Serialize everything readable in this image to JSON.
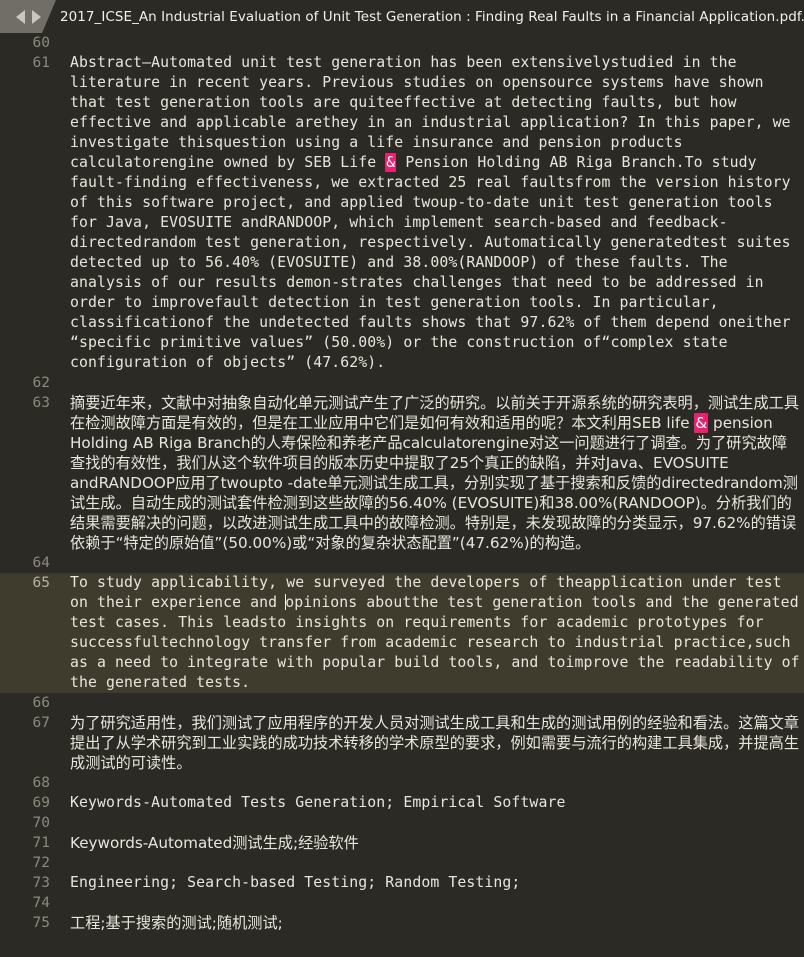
{
  "window": {
    "app": "text-editor",
    "background_color": "#2b2a24",
    "accent_highlight_color": "#e8226e",
    "active_line_color": "#3f3c2e"
  },
  "tabbar": {
    "background_color": "#706e66",
    "prev_arrow": "prev-tab-arrow",
    "next_arrow": "next-tab-arrow",
    "tab": {
      "title": "2017_ICSE_An Industrial Evaluation of Unit Test Generation : Finding Real Faults in a Financial Application.pdf.txt",
      "close_label": "×"
    }
  },
  "editor": {
    "active_line_number": 65,
    "lines": [
      {
        "number": "60",
        "text": "",
        "type": "blank"
      },
      {
        "number": "61",
        "type": "text-with-highlight",
        "script": "latin",
        "segments": [
          {
            "t": "Abstract—Automated unit test generation has been extensivelystudied in the literature in recent years. Previous studies on opensource systems have shown that test generation tools are quiteeffective at detecting faults, but how effective and applicable arethey in an industrial application? In this paper, we investigate thisquestion using a life insurance and pension products calculatorengine owned by SEB Life "
          },
          {
            "t": "&",
            "hl": true
          },
          {
            "t": " Pension Holding AB Riga Branch.To study fault-finding effectiveness, we extracted 25 real faultsfrom the version history of this software project, and applied twoup-to-date unit test generation tools for Java, EVOSUITE andRANDOOP, which implement search-based and feedback-directedrandom test generation, respectively. Automatically generatedtest suites detected up to 56.40% (EVOSUITE) and 38.00%(RANDOOP) of these faults. The analysis of our results demon-strates challenges that need to be addressed in order to improvefault detection in test generation tools. In particular, classificationof the undetected faults shows that 97.62% of them depend oneither “specific primitive values” (50.00%) or the construction of“complex state configuration of objects” (47.62%)."
          }
        ]
      },
      {
        "number": "62",
        "text": "",
        "type": "blank"
      },
      {
        "number": "63",
        "type": "text-with-highlight",
        "script": "cjk",
        "segments": [
          {
            "t": "摘要近年来，文献中对抽象自动化单元测试产生了广泛的研究。以前关于开源系统的研究表明，测试生成工具在检测故障方面是有效的，但是在工业应用中它们是如何有效和适用的呢？本文利用SEB life "
          },
          {
            "t": "&",
            "hl": true
          },
          {
            "t": " pension Holding AB Riga Branch的人寿保险和养老产品calculatorengine对这一问题进行了调查。为了研究故障查找的有效性，我们从这个软件项目的版本历史中提取了25个真正的缺陷，并对Java、EVOSUITE andRANDOOP应用了twoupto -date单元测试生成工具，分别实现了基于搜索和反馈的directedrandom测试生成。自动生成的测试套件检测到这些故障的56.40% (EVOSUITE)和38.00%(RANDOOP)。分析我们的结果需要解决的问题，以改进测试生成工具中的故障检测。特别是，未发现故障的分类显示，97.62%的错误依赖于“特定的原始值”(50.00%)或“对象的复杂状态配置”(47.62%)的构造。"
          }
        ]
      },
      {
        "number": "64",
        "text": "",
        "type": "blank"
      },
      {
        "number": "65",
        "type": "text-with-caret",
        "script": "latin",
        "active": true,
        "segments": [
          {
            "t": "To study applicability, we surveyed the developers of theapplication under test on their experience and "
          },
          {
            "caret": true
          },
          {
            "t": "opinions aboutthe test generation tools and the generated test cases. This leadsto insights on requirements for academic prototypes for successfultechnology transfer from academic research to industrial practice,such as a need to integrate with popular build tools, and toimprove the readability of the generated tests."
          }
        ]
      },
      {
        "number": "66",
        "text": "",
        "type": "blank"
      },
      {
        "number": "67",
        "type": "text",
        "script": "cjk",
        "text": "为了研究适用性，我们测试了应用程序的开发人员对测试生成工具和生成的测试用例的经验和看法。这篇文章提出了从学术研究到工业实践的成功技术转移的学术原型的要求，例如需要与流行的构建工具集成，并提高生成测试的可读性。"
      },
      {
        "number": "68",
        "text": "",
        "type": "blank"
      },
      {
        "number": "69",
        "type": "text",
        "script": "latin",
        "text": "Keywords-Automated Tests Generation; Empirical Software"
      },
      {
        "number": "70",
        "text": "",
        "type": "blank"
      },
      {
        "number": "71",
        "type": "text",
        "script": "cjk",
        "text": "Keywords-Automated测试生成;经验软件"
      },
      {
        "number": "72",
        "text": "",
        "type": "blank"
      },
      {
        "number": "73",
        "type": "text",
        "script": "latin",
        "text": "Engineering; Search-based Testing; Random Testing;"
      },
      {
        "number": "74",
        "text": "",
        "type": "blank"
      },
      {
        "number": "75",
        "type": "text",
        "script": "cjk",
        "text": "工程;基于搜索的测试;随机测试;"
      }
    ]
  }
}
